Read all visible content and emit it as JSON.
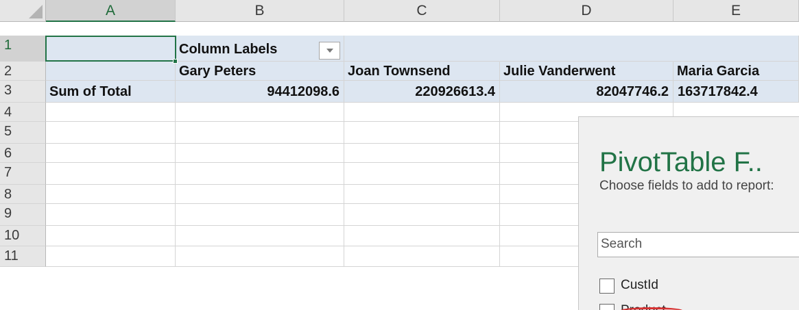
{
  "columns": [
    "A",
    "B",
    "C",
    "D",
    "E"
  ],
  "rows": [
    "1",
    "2",
    "3",
    "4",
    "5",
    "6",
    "7",
    "8",
    "9",
    "10",
    "11"
  ],
  "pivot": {
    "column_labels": "Column Labels",
    "sum_label": "Sum of Total",
    "headers": [
      "Gary Peters",
      "Joan Townsend",
      "Julie Vanderwent",
      "Maria Garcia"
    ],
    "values": [
      "94412098.6",
      "220926613.4",
      "82047746.2",
      "163717842.4"
    ]
  },
  "field_pane": {
    "title": "PivotTable F..",
    "instructions": "Choose fields to add to report:",
    "search_placeholder": "Search",
    "fields": [
      "CustId",
      "Product"
    ]
  },
  "colors": {
    "pivot_fill": "#dde6f1",
    "header_fill": "#e6e6e6",
    "excel_green": "#217346",
    "annotation_red": "#d83232"
  }
}
